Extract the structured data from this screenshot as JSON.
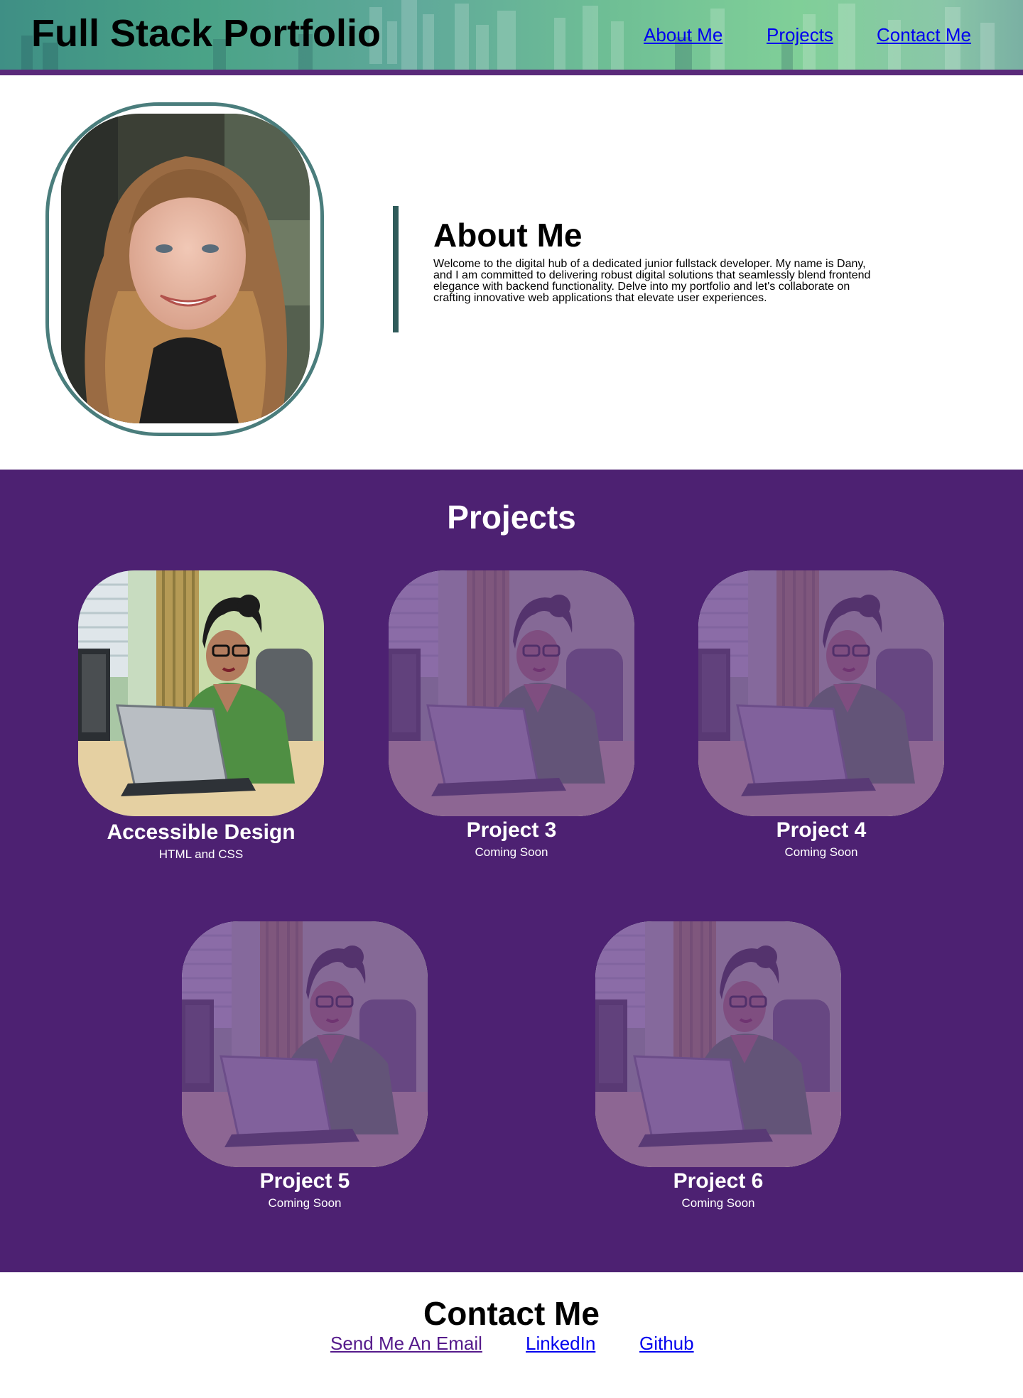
{
  "header": {
    "title": "Full Stack Portfolio",
    "nav": [
      "About Me",
      "Projects",
      "Contact Me"
    ]
  },
  "about": {
    "title": "About Me",
    "text": "Welcome to the digital hub of a dedicated junior fullstack developer. My name is Dany, and I am committed to delivering robust digital solutions that seamlessly blend frontend elegance with backend functionality. Delve into my portfolio and let's collaborate on crafting innovative web applications that elevate user experiences."
  },
  "projects": {
    "title": "Projects",
    "items": [
      {
        "title": "Accessible Design",
        "subtitle": "HTML and CSS"
      },
      {
        "title": "Project 3",
        "subtitle": "Coming Soon"
      },
      {
        "title": "Project 4",
        "subtitle": "Coming Soon"
      },
      {
        "title": "Project 5",
        "subtitle": "Coming Soon"
      },
      {
        "title": "Project 6",
        "subtitle": "Coming Soon"
      }
    ]
  },
  "contact": {
    "title": "Contact Me",
    "links": [
      "Send Me An Email",
      "LinkedIn",
      "Github"
    ]
  },
  "colors": {
    "projects_bg": "#4d2172",
    "header_bar": "#5a2a7a",
    "accent_teal": "#4a7d7c",
    "link_blue": "#0000ee",
    "link_visited": "#551a8b"
  }
}
